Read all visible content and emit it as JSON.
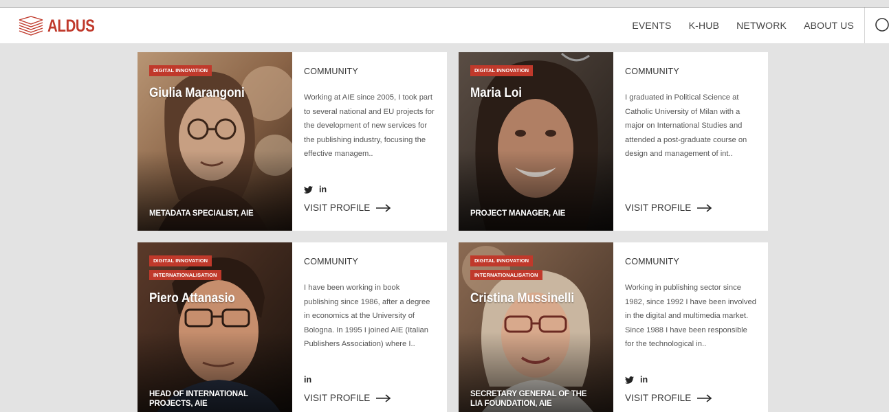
{
  "brand": {
    "name": "ALDUS",
    "accent": "#c0392b"
  },
  "nav": {
    "items": [
      "EVENTS",
      "K-HUB",
      "NETWORK",
      "ABOUT US"
    ],
    "search_icon": "search-icon"
  },
  "cards": [
    {
      "tags": [
        "DIGITAL INNOVATION"
      ],
      "name": "Giulia Marangoni",
      "role": "METADATA SPECIALIST, AIE",
      "section": "COMMUNITY",
      "bio": "Working at AIE since 2005, I took part to several national and EU projects for the development of new services for the publishing industry, focusing the effective managem..",
      "socials": [
        "twitter",
        "in"
      ],
      "visit_label": "VISIT PROFILE"
    },
    {
      "tags": [
        "DIGITAL INNOVATION"
      ],
      "name": "Maria Loi",
      "role": "PROJECT MANAGER, AIE",
      "section": "COMMUNITY",
      "bio": "I graduated in Political Science at Catholic University of Milan with a major on International Studies and attended a post-graduate course on design and management of int..",
      "socials": [],
      "visit_label": "VISIT PROFILE"
    },
    {
      "tags": [
        "DIGITAL INNOVATION",
        "INTERNATIONALISATION"
      ],
      "name": "Piero Attanasio",
      "role": "HEAD OF INTERNATIONAL PROJECTS, AIE",
      "section": "COMMUNITY",
      "bio": "I have been working in book publishing since 1986, after a degree in economics at the University of Bologna. In 1995 I joined AIE (Italian Publishers Association) where I..",
      "socials": [
        "in"
      ],
      "visit_label": "VISIT PROFILE"
    },
    {
      "tags": [
        "DIGITAL INNOVATION",
        "INTERNATIONALISATION"
      ],
      "name": "Cristina Mussinelli",
      "role": "SECRETARY GENERAL OF THE LIA FOUNDATION, AIE",
      "section": "COMMUNITY",
      "bio": "Working in publishing sector since 1982, since 1992 I have been involved in the digital and multimedia market. Since 1988 I have been responsible for the technological in..",
      "socials": [
        "twitter",
        "in"
      ],
      "visit_label": "VISIT PROFILE"
    }
  ]
}
